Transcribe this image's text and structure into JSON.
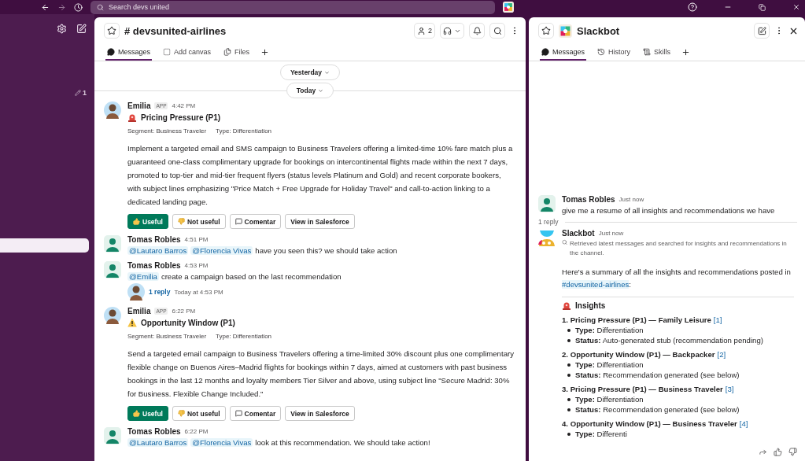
{
  "topbar": {
    "search_placeholder": "Search devs united"
  },
  "sidebar": {
    "draft_count": "1"
  },
  "channel": {
    "title": "# devsunited-airlines",
    "member_count": "2",
    "tabs": [
      {
        "label": "Messages",
        "selected": true
      },
      {
        "label": "Add canvas",
        "selected": false
      },
      {
        "label": "Files",
        "selected": false
      }
    ],
    "dividers": [
      "Yesterday",
      "Today"
    ],
    "messages": [
      {
        "kind": "app",
        "author": "Emilia",
        "badge": "APP",
        "time": "4:42 PM",
        "title": "Pricing Pressure (P1)",
        "segment": "Segment: Business Traveler",
        "type": "Type: Differentiation",
        "body": "Implement a targeted email and SMS campaign to Business Travelers offering a limited-time 10% fare match plus a guaranteed one-class complimentary upgrade for bookings on intercontinental flights made within the next 7 days, promoted to top-tier and mid-tier frequent flyers (status levels Platinum and Gold) and recent corporate bookers, with subject lines emphasizing \"Price Match + Free Upgrade for Holiday Travel\" and call-to-action linking to a dedicated landing page.",
        "actions": [
          {
            "label": "Useful",
            "kind": "positive"
          },
          {
            "label": "Not useful",
            "kind": "negative"
          },
          {
            "label": "Comentar",
            "kind": "comment"
          },
          {
            "label": "View in Salesforce",
            "kind": "link"
          }
        ]
      },
      {
        "kind": "user",
        "author": "Tomas Robles",
        "time": "4:51 PM",
        "mentions": [
          "@Lautaro Barros",
          "@Florencia Vivas"
        ],
        "text": "have you seen this? we should take action"
      },
      {
        "kind": "user",
        "author": "Tomas Robles",
        "time": "4:53 PM",
        "mentions": [
          "@Emilia"
        ],
        "text": "create a campaign based on the last recommendation",
        "thread": {
          "replies": "1 reply",
          "time": "Today at 4:53 PM"
        }
      },
      {
        "kind": "app",
        "author": "Emilia",
        "badge": "APP",
        "time": "6:22 PM",
        "title": "Opportunity Window (P1)",
        "segment": "Segment: Business Traveler",
        "type": "Type: Differentiation",
        "body": "Send a targeted email campaign to Business Travelers offering a time-limited 30% discount plus one complimentary flexible change on Buenos Aires–Madrid flights for bookings within 7 days, aimed at customers with past business bookings in the last 12 months and loyalty members Tier Silver and above, using subject line \"Secure Madrid: 30% for Business. Flexible Change Included.\"",
        "actions": [
          {
            "label": "Useful",
            "kind": "positive"
          },
          {
            "label": "Not useful",
            "kind": "negative"
          },
          {
            "label": "Comentar",
            "kind": "comment"
          },
          {
            "label": "View in Salesforce",
            "kind": "link"
          }
        ]
      },
      {
        "kind": "user",
        "author": "Tomas Robles",
        "time": "6:22 PM",
        "mentions": [
          "@Lautaro Barros",
          "@Florencia Vivas"
        ],
        "text": "look at this recommendation. We should take action!"
      }
    ]
  },
  "assistant": {
    "title": "Slackbot",
    "tabs": [
      {
        "label": "Messages",
        "selected": true
      },
      {
        "label": "History",
        "selected": false
      },
      {
        "label": "Skills",
        "selected": false
      }
    ],
    "question": {
      "author": "Tomas Robles",
      "time": "Just now",
      "text": "give me a resume of all insights and recommendations we have"
    },
    "replies": "1 reply",
    "answer": {
      "author": "Slackbot",
      "time": "Just now",
      "status": "Retrieved latest messages and searched for insights and recommendations in the channel.",
      "intro": "Here's a summary of all the insights and recommendations posted in",
      "channel_link": "#devsunited-airlines",
      "intro_end": ":",
      "section": "Insights",
      "items": [
        {
          "title": "1. Pricing Pressure (P1) — Family Leisure",
          "ref": "[1]",
          "bullets": [
            {
              "label": "Type:",
              "value": "Differentiation"
            },
            {
              "label": "Status:",
              "value": "Auto-generated stub (recommendation pending)"
            }
          ]
        },
        {
          "title": "2. Opportunity Window (P1) — Backpacker",
          "ref": "[2]",
          "bullets": [
            {
              "label": "Type:",
              "value": "Differentiation"
            },
            {
              "label": "Status:",
              "value": "Recommendation generated (see below)"
            }
          ]
        },
        {
          "title": "3. Pricing Pressure (P1) — Business Traveler",
          "ref": "[3]",
          "bullets": [
            {
              "label": "Type:",
              "value": "Differentiation"
            },
            {
              "label": "Status:",
              "value": "Recommendation generated (see below)"
            }
          ]
        },
        {
          "title": "4. Opportunity Window (P1) — Business Traveler",
          "ref": "[4]",
          "bullets": [
            {
              "label": "Type:",
              "value": "Differenti"
            }
          ]
        }
      ]
    }
  }
}
